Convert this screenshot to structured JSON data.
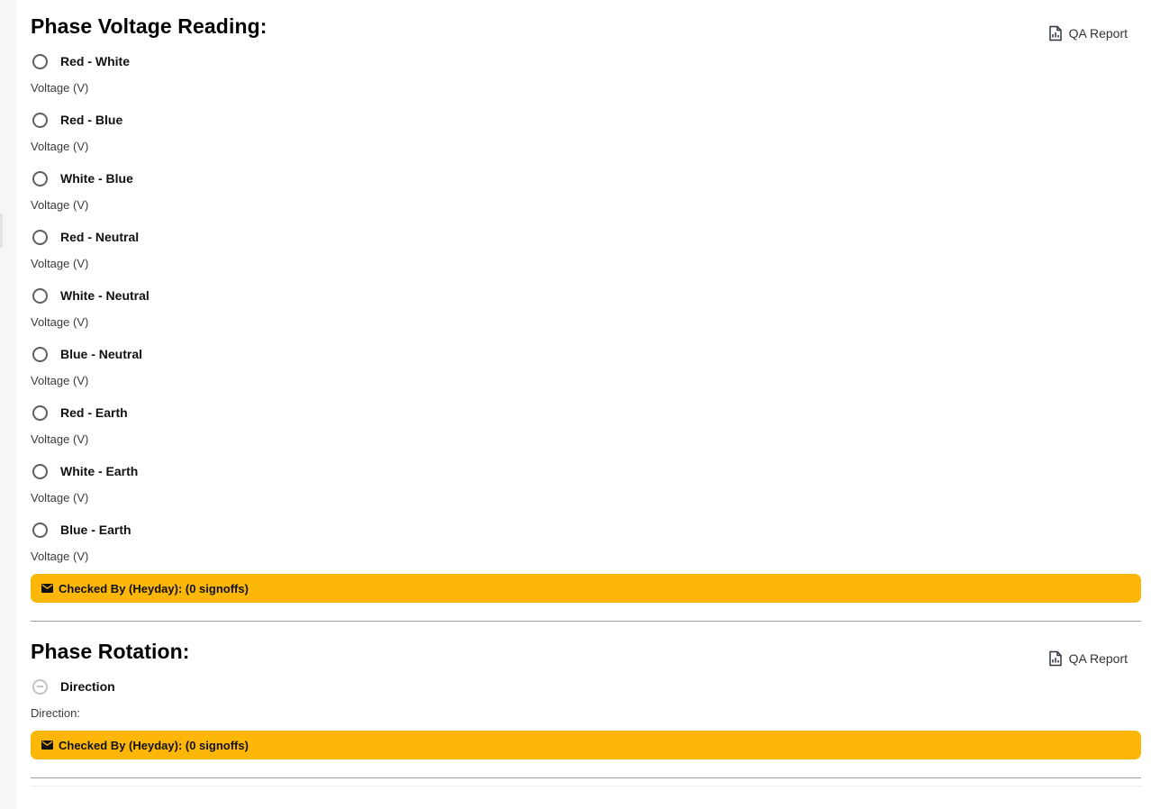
{
  "sections": [
    {
      "title": "Phase Voltage Reading:",
      "qa_report_label": "QA Report",
      "items": [
        {
          "label": "Red - White",
          "sub": "Voltage (V)"
        },
        {
          "label": "Red - Blue",
          "sub": "Voltage (V)"
        },
        {
          "label": "White - Blue",
          "sub": "Voltage (V)"
        },
        {
          "label": "Red - Neutral",
          "sub": "Voltage (V)"
        },
        {
          "label": "White - Neutral",
          "sub": "Voltage (V)"
        },
        {
          "label": "Blue - Neutral",
          "sub": "Voltage (V)"
        },
        {
          "label": "Red - Earth",
          "sub": "Voltage (V)"
        },
        {
          "label": "White - Earth",
          "sub": "Voltage (V)"
        },
        {
          "label": "Blue - Earth",
          "sub": "Voltage (V)"
        }
      ],
      "signoff_label": "Checked By (Heyday): (0 signoffs)"
    },
    {
      "title": "Phase Rotation:",
      "qa_report_label": "QA Report",
      "items": [
        {
          "label": "Direction",
          "sub": "Direction:"
        }
      ],
      "signoff_label": "Checked By (Heyday): (0 signoffs)"
    }
  ],
  "colors": {
    "signoff_bg": "#fdb709",
    "divider": "#9e9e9e",
    "radio_border": "#5f5f5f",
    "radio_disabled": "#c4c4c4"
  }
}
